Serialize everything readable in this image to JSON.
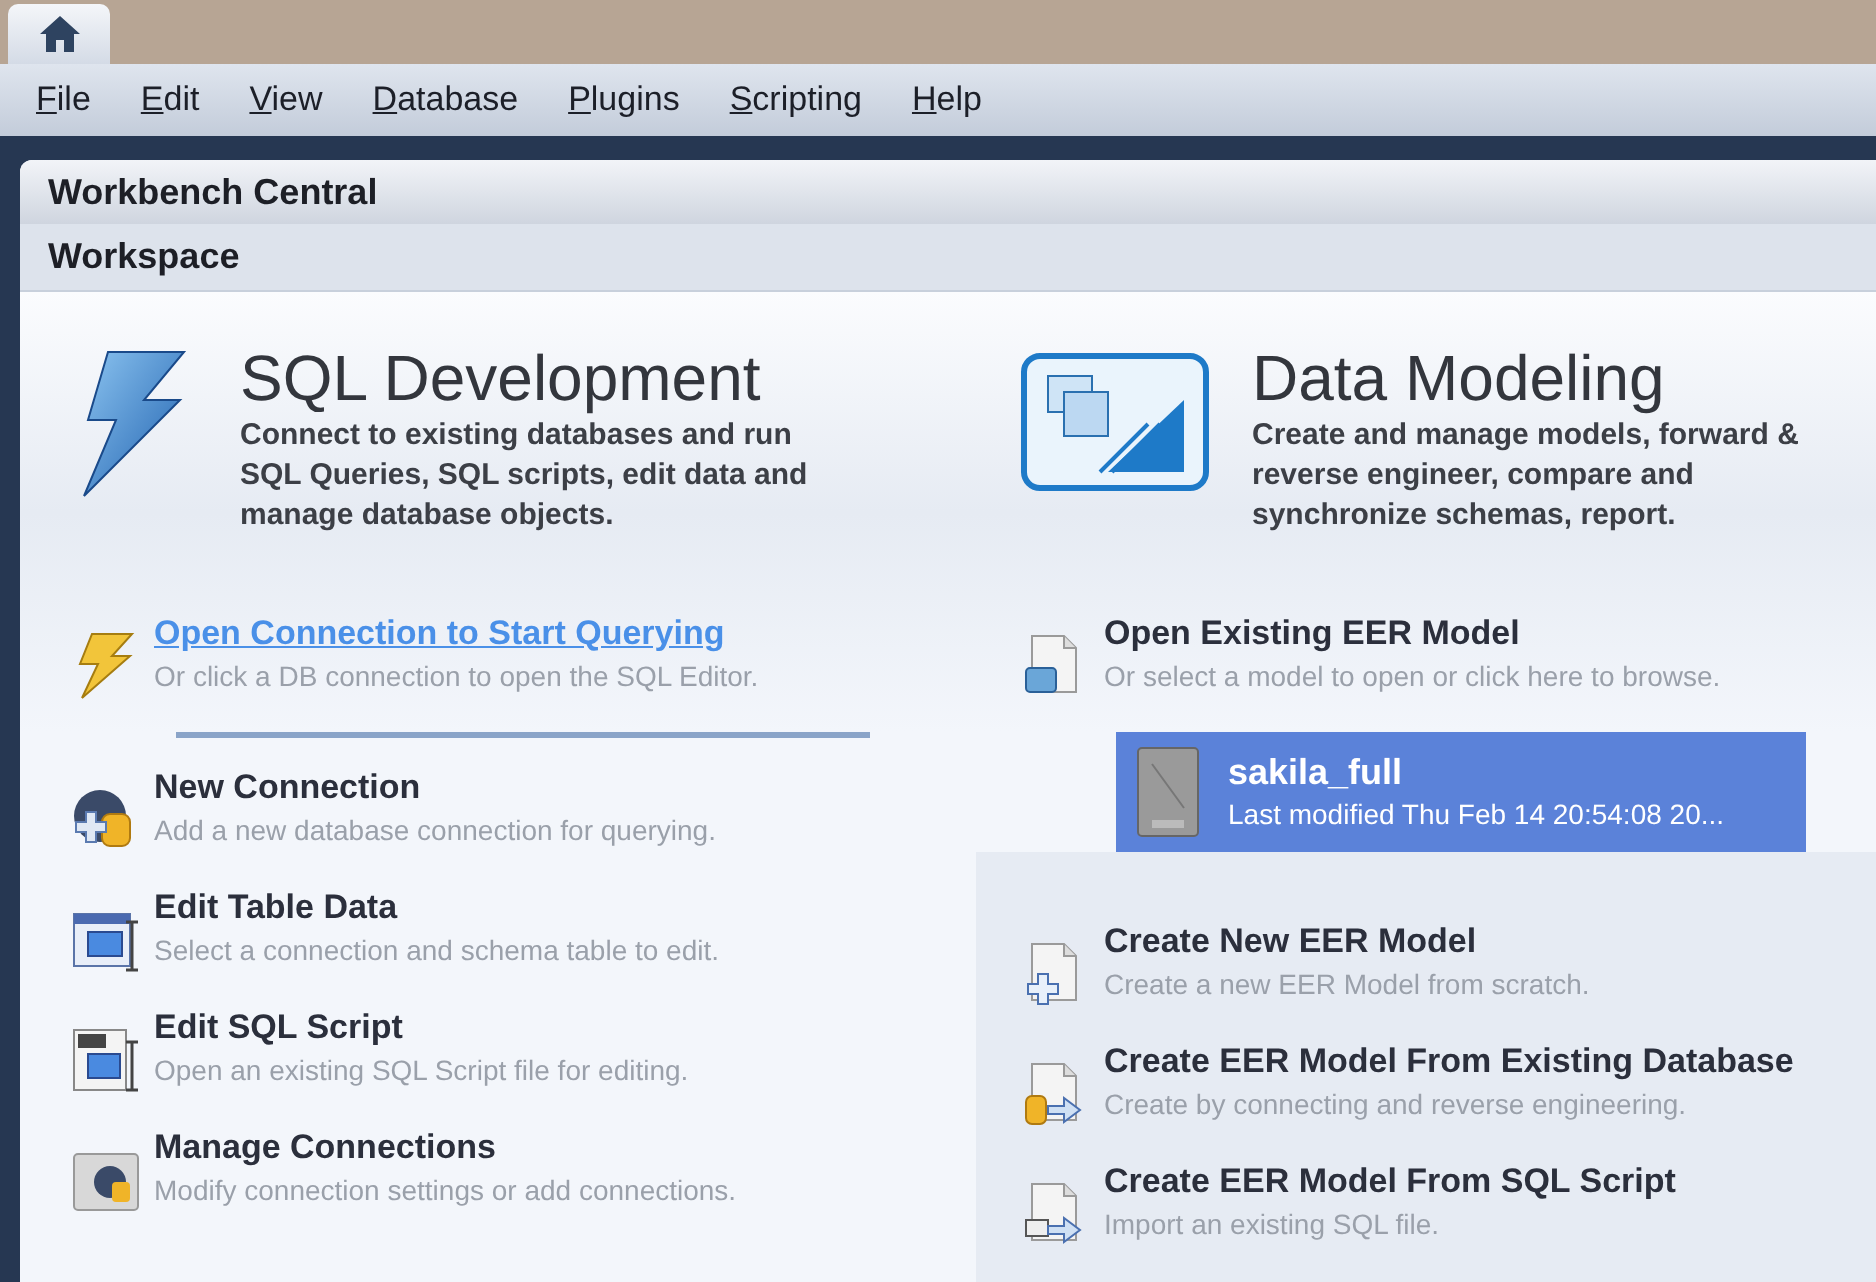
{
  "menu": [
    "File",
    "Edit",
    "View",
    "Database",
    "Plugins",
    "Scripting",
    "Help"
  ],
  "header": {
    "title": "Workbench Central"
  },
  "workspace": {
    "title": "Workspace"
  },
  "sql_development": {
    "title": "SQL Development",
    "description": "Connect to existing databases and run SQL Queries, SQL scripts, edit data and manage database objects.",
    "primary_action": {
      "title": "Open Connection to Start Querying",
      "subtitle": "Or click a DB connection to open the SQL Editor."
    },
    "actions": [
      {
        "kind": "new-connection",
        "title": "New Connection",
        "subtitle": "Add a new database connection for querying."
      },
      {
        "kind": "edit-table",
        "title": "Edit Table Data",
        "subtitle": "Select a connection and schema table to edit."
      },
      {
        "kind": "edit-script",
        "title": "Edit SQL Script",
        "subtitle": "Open an existing SQL Script file for editing."
      },
      {
        "kind": "manage",
        "title": "Manage Connections",
        "subtitle": "Modify connection settings or add connections."
      }
    ]
  },
  "data_modeling": {
    "title": "Data Modeling",
    "description": "Create and manage models, forward & reverse engineer, compare and synchronize schemas, report.",
    "open_action": {
      "title": "Open Existing EER Model",
      "subtitle": "Or select a model to open or click here to browse."
    },
    "models": [
      {
        "name": "sakila_full",
        "modified": "Last modified Thu Feb 14 20:54:08 20...",
        "selected": true
      }
    ],
    "actions": [
      {
        "kind": "new-model",
        "title": "Create New EER Model",
        "subtitle": "Create a new EER Model from scratch."
      },
      {
        "kind": "from-database",
        "title": "Create EER Model From Existing Database",
        "subtitle": "Create by connecting and reverse engineering."
      },
      {
        "kind": "from-script",
        "title": "Create EER Model From SQL Script",
        "subtitle": "Import an existing SQL file."
      }
    ]
  }
}
